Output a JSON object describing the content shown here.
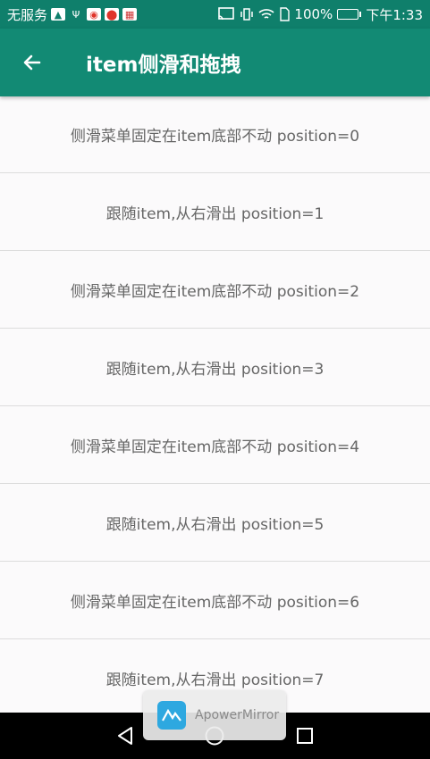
{
  "status_bar": {
    "carrier": "无服务",
    "battery_percent": "100%",
    "time": "下午1:33",
    "icons": [
      "mirror-icon",
      "usb-icon",
      "weibo-icon",
      "maps-icon",
      "calendar-icon",
      "cast-icon",
      "vibrate-icon",
      "wifi-icon",
      "sim-icon",
      "battery-icon"
    ]
  },
  "app_bar": {
    "title": "item侧滑和拖拽",
    "back_icon": "back-arrow-icon"
  },
  "list": {
    "items": [
      {
        "label": "侧滑菜单固定在item底部不动  position=0"
      },
      {
        "label": "跟随item,从右滑出  position=1"
      },
      {
        "label": "侧滑菜单固定在item底部不动  position=2"
      },
      {
        "label": "跟随item,从右滑出  position=3"
      },
      {
        "label": "侧滑菜单固定在item底部不动  position=4"
      },
      {
        "label": "跟随item,从右滑出  position=5"
      },
      {
        "label": "侧滑菜单固定在item底部不动  position=6"
      },
      {
        "label": "跟随item,从右滑出  position=7"
      }
    ]
  },
  "watermark": {
    "text": "ApowerMirror"
  },
  "colors": {
    "status_bar": "#0f7f6b",
    "app_bar": "#128a74",
    "list_bg": "#fbfafb",
    "text": "#666666"
  }
}
